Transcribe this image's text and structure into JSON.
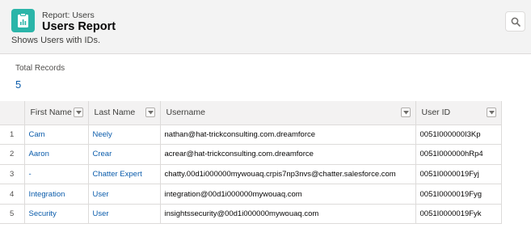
{
  "header": {
    "kicker": "Report: Users",
    "title": "Users Report",
    "description": "Shows Users with IDs.",
    "icon": "report-icon",
    "accent_color": "#2bb5a9"
  },
  "summary": {
    "label": "Total Records",
    "value": "5"
  },
  "table": {
    "columns": [
      "First Name",
      "Last Name",
      "Username",
      "User ID"
    ],
    "rows": [
      {
        "num": "1",
        "first": "Cam",
        "last": "Neely",
        "username": "nathan@hat-trickconsulting.com.dreamforce",
        "id": "0051I000000I3Kp"
      },
      {
        "num": "2",
        "first": "Aaron",
        "last": "Crear",
        "username": "acrear@hat-trickconsulting.com.dreamforce",
        "id": "0051I000000hRp4"
      },
      {
        "num": "3",
        "first": "-",
        "last": "Chatter Expert",
        "username": "chatty.00d1i000000mywouaq.crpis7np3nvs@chatter.salesforce.com",
        "id": "0051I0000019Fyj"
      },
      {
        "num": "4",
        "first": "Integration",
        "last": "User",
        "username": "integration@00d1i000000mywouaq.com",
        "id": "0051I0000019Fyg"
      },
      {
        "num": "5",
        "first": "Security",
        "last": "User",
        "username": "insightssecurity@00d1i000000mywouaq.com",
        "id": "0051I0000019Fyk"
      }
    ]
  },
  "link_color": "#0b5cab"
}
